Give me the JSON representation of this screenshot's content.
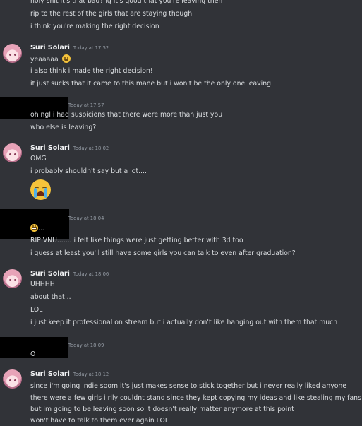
{
  "messages": {
    "m0": {
      "lines": [
        "holy shit it's that bad? ig it's good that you're leaving then",
        "rip to the rest of the girls that are staying though",
        "i think you're making the right decision"
      ]
    },
    "m1": {
      "author": "Suri Solari",
      "time": "Today at 17:52",
      "text": "yeaaaaa",
      "emoji": "face-holding-back-tears",
      "lines": [
        "i also think i made the right decision!",
        "it just sucks that it came to this mane but i won't be the only one leaving"
      ]
    },
    "m2": {
      "time": "Today at 17:57",
      "lines": [
        "oh ngl i had suspicions that there were more than just you",
        "who else is leaving?"
      ]
    },
    "m3": {
      "author": "Suri Solari",
      "time": "Today at 18:02",
      "lines": [
        "OMG",
        "i probably shouldn't say but a lot...."
      ],
      "emoji": "loudly-crying-face"
    },
    "m4": {
      "time": "Today at 18:04",
      "emoji": "grimacing-face",
      "emoji_suffix": "...",
      "lines": [
        "RIP VNU....... i felt like things were just getting better with 3d too",
        "i guess at least you'll still have some girls you can talk to even after graduation?"
      ]
    },
    "m5": {
      "author": "Suri Solari",
      "time": "Today at 18:06",
      "lines": [
        "UHHHH",
        "about that ..",
        "LOL",
        "i just keep it professional on stream but i actually don't like hanging out with them that much"
      ]
    },
    "m6": {
      "time": "Today at 18:09",
      "lines": [
        "O"
      ]
    },
    "m7": {
      "author": "Suri Solari",
      "time": "Today at 18:12",
      "line1": "since i'm going indie soom it's just makes sense to stick together but i never really liked anyone",
      "line2_plain": "there were a few girls i rlly couldnt stand since ",
      "line2_strike": "they kept copying my ideas and like stealing my fans",
      "line3": "but im going to be leaving soon so it doesn't really matter anymore at this point",
      "line4": "won't have to talk to them ever again LOL"
    }
  },
  "colors": {
    "background": "#313338",
    "text": "#dbdee1",
    "username": "#f2f3f5",
    "timestamp": "#949ba4",
    "redaction": "#000000"
  }
}
